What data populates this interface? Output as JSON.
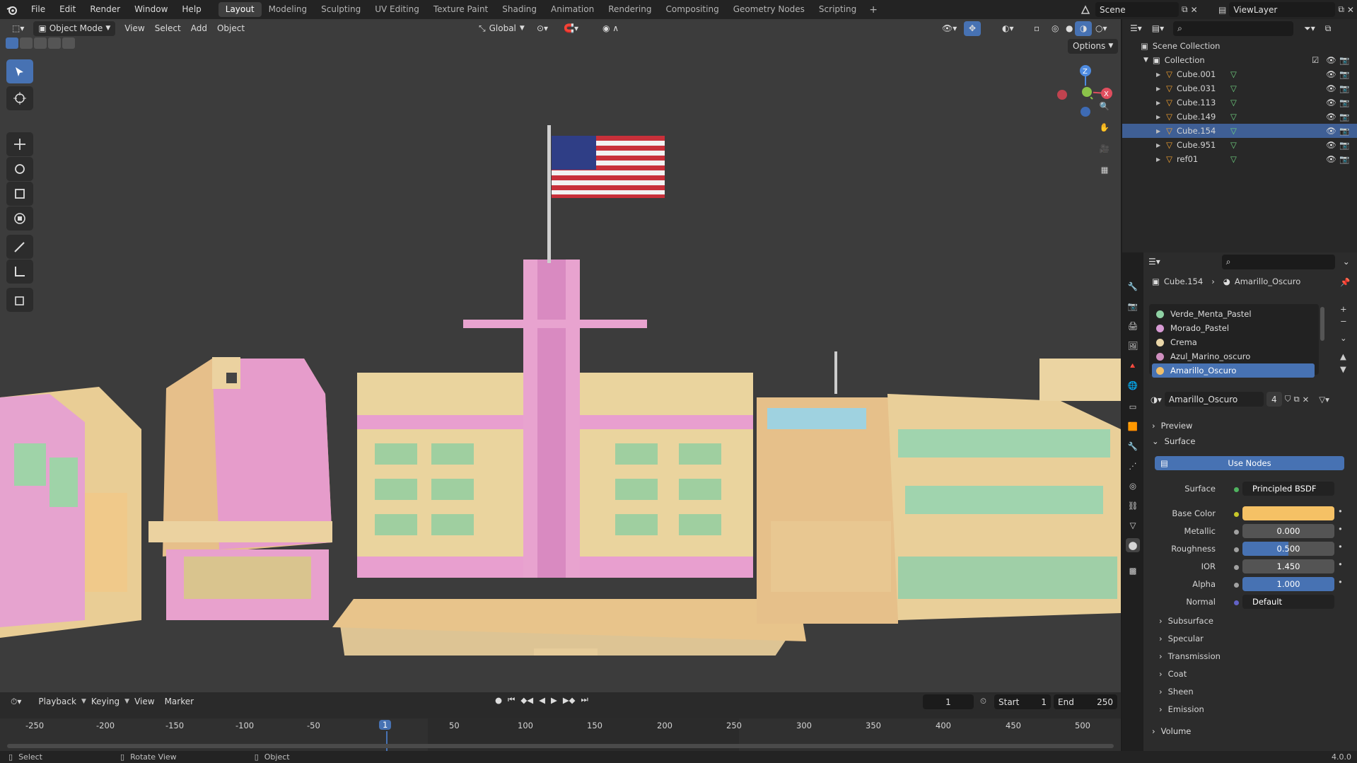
{
  "topbar": {
    "menus": [
      "File",
      "Edit",
      "Render",
      "Window",
      "Help"
    ],
    "workspaces": [
      "Layout",
      "Modeling",
      "Sculpting",
      "UV Editing",
      "Texture Paint",
      "Shading",
      "Animation",
      "Rendering",
      "Compositing",
      "Geometry Nodes",
      "Scripting"
    ],
    "active_workspace": "Layout",
    "add_tab": "+",
    "scene": "Scene",
    "view_layer": "ViewLayer"
  },
  "viewport": {
    "mode": "Object Mode",
    "menus": [
      "View",
      "Select",
      "Add",
      "Object"
    ],
    "transform_orientation": "Global",
    "options": "Options",
    "gizmo": {
      "z": "Z",
      "x": "X"
    }
  },
  "outliner": {
    "scene_collection": "Scene Collection",
    "collection": "Collection",
    "objects": [
      {
        "name": "Cube.001"
      },
      {
        "name": "Cube.031"
      },
      {
        "name": "Cube.113"
      },
      {
        "name": "Cube.149"
      },
      {
        "name": "Cube.154",
        "selected": true
      },
      {
        "name": "Cube.951"
      },
      {
        "name": "ref01"
      }
    ]
  },
  "properties": {
    "breadcrumb_object": "Cube.154",
    "breadcrumb_material": "Amarillo_Oscuro",
    "materials": [
      {
        "name": "Verde_Menta_Pastel",
        "color": "#8fd1a4"
      },
      {
        "name": "Morado_Pastel",
        "color": "#d79ad4"
      },
      {
        "name": "Crema",
        "color": "#e9d6a8"
      },
      {
        "name": "Azul_Marino_oscuro",
        "color": "#cf8fbf"
      },
      {
        "name": "Amarillo_Oscuro",
        "color": "#f0bf6a",
        "selected": true
      }
    ],
    "material_name": "Amarillo_Oscuro",
    "user_count": "4",
    "sections": {
      "preview": "Preview",
      "surface": "Surface",
      "volume": "Volume"
    },
    "use_nodes": "Use Nodes",
    "surface_label": "Surface",
    "surface_value": "Principled BSDF",
    "base_color_label": "Base Color",
    "base_color": "#f5c165",
    "metallic_label": "Metallic",
    "metallic": "0.000",
    "roughness_label": "Roughness",
    "roughness": "0.500",
    "ior_label": "IOR",
    "ior": "1.450",
    "alpha_label": "Alpha",
    "alpha": "1.000",
    "normal_label": "Normal",
    "normal": "Default",
    "subsections": [
      "Subsurface",
      "Specular",
      "Transmission",
      "Coat",
      "Sheen",
      "Emission"
    ]
  },
  "timeline": {
    "menus": [
      "Playback",
      "Keying",
      "View",
      "Marker"
    ],
    "current_frame": "1",
    "start_label": "Start",
    "start": "1",
    "end_label": "End",
    "end": "250",
    "ruler": [
      "-250",
      "-200",
      "-150",
      "-100",
      "-50",
      "1",
      "50",
      "100",
      "150",
      "200",
      "250",
      "300",
      "350",
      "400",
      "450",
      "500"
    ]
  },
  "status": {
    "select": "Select",
    "rotate": "Rotate View",
    "object": "Object",
    "version": "4.0.0"
  }
}
